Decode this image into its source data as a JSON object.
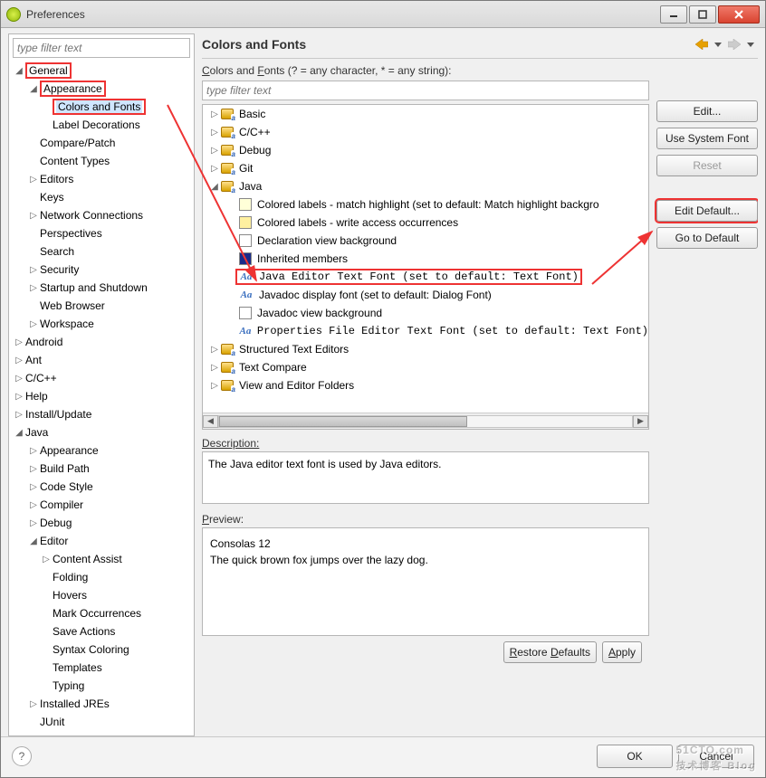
{
  "window": {
    "title": "Preferences"
  },
  "sidebar_filter_placeholder": "type filter text",
  "sidebar": {
    "general": "General",
    "appearance": "Appearance",
    "colors_fonts": "Colors and Fonts",
    "label_decorations": "Label Decorations",
    "compare_patch": "Compare/Patch",
    "content_types": "Content Types",
    "editors": "Editors",
    "keys": "Keys",
    "network": "Network Connections",
    "perspectives": "Perspectives",
    "search": "Search",
    "security": "Security",
    "startup": "Startup and Shutdown",
    "web_browser": "Web Browser",
    "workspace": "Workspace",
    "android": "Android",
    "ant": "Ant",
    "cpp": "C/C++",
    "help": "Help",
    "install_update": "Install/Update",
    "java": "Java",
    "j_appearance": "Appearance",
    "j_build_path": "Build Path",
    "j_code_style": "Code Style",
    "j_compiler": "Compiler",
    "j_debug": "Debug",
    "j_editor": "Editor",
    "j_content_assist": "Content Assist",
    "j_folding": "Folding",
    "j_hovers": "Hovers",
    "j_mark": "Mark Occurrences",
    "j_save": "Save Actions",
    "j_syntax": "Syntax Coloring",
    "j_templates": "Templates",
    "j_typing": "Typing",
    "j_installed": "Installed JREs",
    "j_junit": "JUnit"
  },
  "panel": {
    "title": "Colors and Fonts",
    "hint": "Colors and Fonts (? = any character, * = any string):",
    "filter_placeholder": "type filter text"
  },
  "cf_tree": {
    "basic": "Basic",
    "cpp": "C/C++",
    "debug": "Debug",
    "git": "Git",
    "java": "Java",
    "colored_match": "Colored labels - match highlight (set to default: Match highlight backgro",
    "colored_write": "Colored labels - write access occurrences",
    "decl_bg": "Declaration view background",
    "inherited": "Inherited members",
    "java_editor_font": "Java Editor Text Font (set to default: Text Font)",
    "javadoc_font": "Javadoc display font (set to default: Dialog Font)",
    "javadoc_bg": "Javadoc view background",
    "props_font": "Properties File Editor Text Font (set to default: Text Font)",
    "structured": "Structured Text Editors",
    "text_compare": "Text Compare",
    "view_folders": "View and Editor Folders"
  },
  "swatch": {
    "match": "#ffffd8",
    "write": "#fff0a0",
    "decl": "#ffffff",
    "inherited": "#1a2b8a",
    "javadoc_bg": "#ffffff"
  },
  "buttons": {
    "edit": "Edit...",
    "use_system": "Use System Font",
    "reset": "Reset",
    "edit_default": "Edit Default...",
    "goto_default": "Go to Default",
    "restore": "Restore Defaults",
    "apply": "Apply",
    "ok": "OK",
    "cancel": "Cancel"
  },
  "description": {
    "label": "Description:",
    "text": "The Java editor text font is used by Java editors."
  },
  "preview": {
    "label": "Preview:",
    "line1": "Consolas 12",
    "line2": "The quick brown fox jumps over the lazy dog."
  },
  "watermark": {
    "main": "51CTO.com",
    "sub": "技术博客  Blog"
  }
}
